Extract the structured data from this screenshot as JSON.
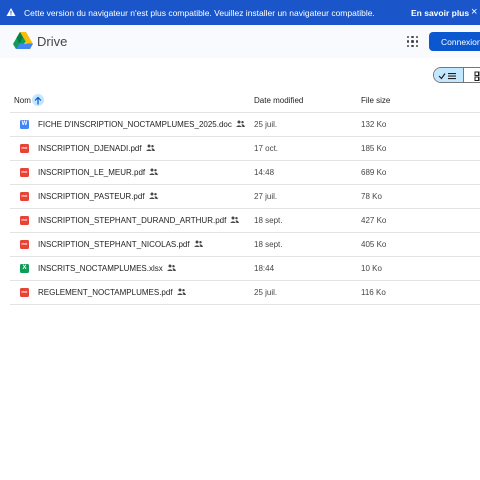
{
  "banner": {
    "icon": "warning-icon",
    "message": "Cette version du navigateur n'est plus compatible. Veuillez installer un navigateur compatible.",
    "learn_more": "En savoir plus",
    "close": "×"
  },
  "header": {
    "logo": "drive-logo-icon",
    "brand": "Drive",
    "apps_icon": "apps-grid-icon",
    "signin": "Connexion"
  },
  "view_toggle": {
    "list_icon": "check-list-icon",
    "grid_icon": "grid-view-icon",
    "selected": "list"
  },
  "table": {
    "columns": {
      "name": "Nom",
      "date": "Date modified",
      "size": "File size"
    },
    "sort_icon": "arrow-up-icon",
    "rows": [
      {
        "name": "FICHE D'INSCRIPTION_NOCTAMPLUMES_2025.doc",
        "type": "word",
        "date": "25 juil.",
        "size": "132 Ko"
      },
      {
        "name": "INSCRIPTION_DJENADI.pdf",
        "type": "pdf",
        "date": "17 oct.",
        "size": "185 Ko"
      },
      {
        "name": "INSCRIPTION_LE_MEUR.pdf",
        "type": "pdf",
        "date": "14:48",
        "size": "689 Ko"
      },
      {
        "name": "INSCRIPTION_PASTEUR.pdf",
        "type": "pdf",
        "date": "27 juil.",
        "size": "78 Ko"
      },
      {
        "name": "INSCRIPTION_STEPHANT_DURAND_ARTHUR.pdf",
        "type": "pdf",
        "date": "18 sept.",
        "size": "427 Ko"
      },
      {
        "name": "INSCRIPTION_STEPHANT_NICOLAS.pdf",
        "type": "pdf",
        "date": "18 sept.",
        "size": "405 Ko"
      },
      {
        "name": "INSCRITS_NOCTAMPLUMES.xlsx",
        "type": "excel",
        "date": "18:44",
        "size": "10 Ko"
      },
      {
        "name": "REGLEMENT_NOCTAMPLUMES.pdf",
        "type": "pdf",
        "date": "25 juil.",
        "size": "116 Ko"
      }
    ]
  },
  "colors": {
    "banner": "#1a56c9",
    "accent": "#0b57d0",
    "pdf": "#ea4335",
    "word": "#4285f4",
    "excel": "#0f9d58"
  }
}
